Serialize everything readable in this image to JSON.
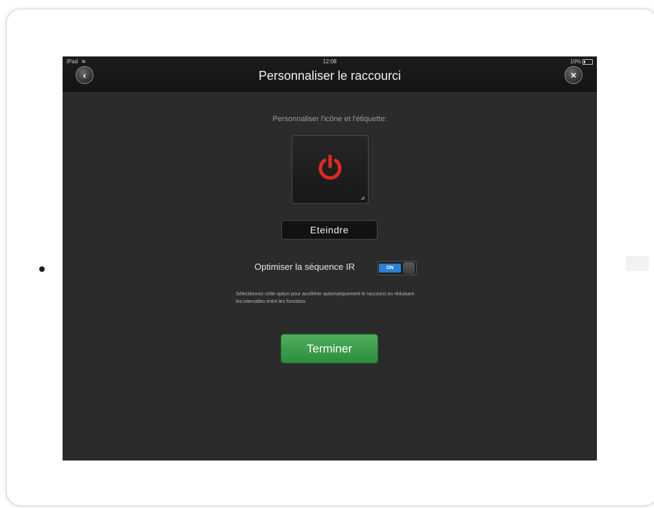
{
  "status_bar": {
    "device": "iPad",
    "wifi_icon": "wifi-icon",
    "time": "12:08",
    "battery": "19%",
    "battery_level": 0.19
  },
  "navbar": {
    "title": "Personnaliser le raccourci",
    "back_icon": "back-chevron-icon",
    "back_symbol": "‹",
    "close_icon": "close-icon",
    "close_symbol": "×"
  },
  "content": {
    "instruction": "Personnaliser l'icône et l'étiquette:",
    "shortcut_icon": "power-icon",
    "icon_color": "#e02a22",
    "label_value": "Eteindre",
    "option_label": "Optimiser la séquence IR",
    "toggle_state": "ON",
    "toggle_color": "#2b7fd4",
    "description": "Sélectionnez cette option pour accélérer automatiquement le raccourci en réduisant les intervalles entre les fonctions",
    "done_label": "Terminer",
    "done_color": "#2b8d3d"
  }
}
